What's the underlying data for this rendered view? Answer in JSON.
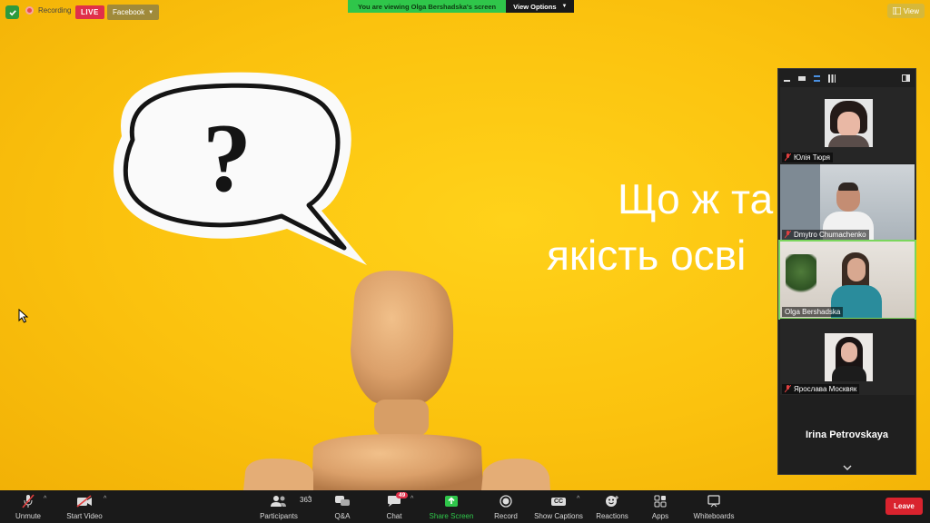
{
  "status_bar": {
    "recording_label": "Recording",
    "live_label": "LIVE",
    "stream_target": "Facebook",
    "screen_share_notice": "You are viewing Olga Bershadska's screen",
    "view_options_label": "View Options",
    "view_label": "View"
  },
  "slide": {
    "text_line1": "Що ж та",
    "text_line2": "якість осві"
  },
  "gallery": {
    "participants": [
      {
        "name": "Юлія Тюря",
        "muted": true
      },
      {
        "name": "Dmytro Chumachenko",
        "muted": true
      },
      {
        "name": "Olga Bershadska",
        "muted": false,
        "active": true
      },
      {
        "name": "Ярослава Москвяк",
        "muted": true
      },
      {
        "name": "Irina Petrovskaya",
        "muted": true
      }
    ]
  },
  "toolbar": {
    "unmute": "Unmute",
    "start_video": "Start Video",
    "participants": "Participants",
    "participant_count": "363",
    "qa": "Q&A",
    "chat": "Chat",
    "chat_badge": "49",
    "share_screen": "Share Screen",
    "record": "Record",
    "show_captions": "Show Captions",
    "cc_icon_text": "CC",
    "reactions": "Reactions",
    "apps": "Apps",
    "whiteboards": "Whiteboards",
    "leave": "Leave"
  },
  "colors": {
    "slide_background": "#fbc20e",
    "share_banner": "#2fc64a",
    "live_badge": "#e0304a",
    "leave_button": "#d9232e",
    "active_speaker_border": "#7bd65d"
  }
}
